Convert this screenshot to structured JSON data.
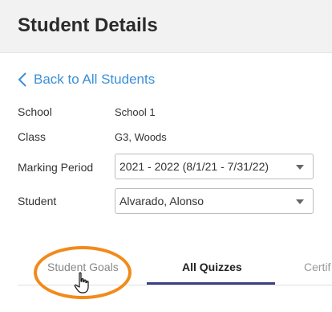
{
  "header": {
    "title": "Student Details"
  },
  "back": {
    "label": "Back to All Students"
  },
  "details": {
    "school_label": "School",
    "school_value": "School 1",
    "class_label": "Class",
    "class_value": "G3, Woods",
    "marking_period_label": "Marking Period",
    "marking_period_value": "2021 - 2022 (8/1/21 - 7/31/22)",
    "student_label": "Student",
    "student_value": "Alvarado, Alonso"
  },
  "tabs": {
    "items": [
      {
        "label": "Student Goals"
      },
      {
        "label": "All Quizzes",
        "active": true
      },
      {
        "label": "Certif"
      }
    ]
  },
  "colors": {
    "accent": "#3a8fd8",
    "tab_active": "#3a3f86",
    "highlight": "#f28a1a"
  },
  "icons": {
    "back": "chevron-left-icon",
    "dropdown": "chevron-down-icon",
    "cursor": "hand-pointer-icon"
  }
}
